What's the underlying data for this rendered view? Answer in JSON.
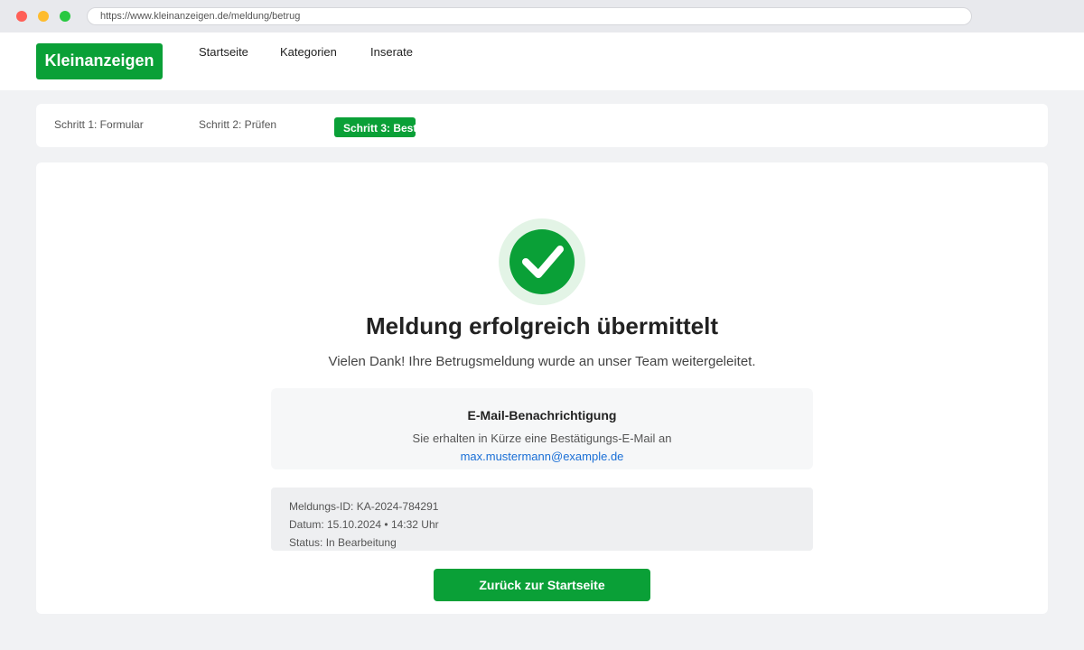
{
  "browser": {
    "url": "https://www.kleinanzeigen.de/meldung/betrug"
  },
  "header": {
    "logo": "Kleinanzeigen",
    "nav": [
      "Startseite",
      "Kategorien",
      "Inserate"
    ]
  },
  "steps": {
    "step1": "Schritt 1: Formular",
    "step2": "Schritt 2: Prüfen",
    "step3": "Schritt 3: Best"
  },
  "confirmation": {
    "icon": "check-circle-icon",
    "title": "Meldung erfolgreich übermittelt",
    "subtitle": "Vielen Dank! Ihre Betrugsmeldung wurde an unser Team weitergeleitet."
  },
  "email_box": {
    "title": "E-Mail-Benachrichtigung",
    "text": "Sie erhalten in Kürze eine Bestätigungs-E-Mail an",
    "address": "max.mustermann@example.de"
  },
  "details": {
    "id": "Meldungs-ID: KA-2024-784291",
    "date": "Datum: 15.10.2024 • 14:32 Uhr",
    "status": "Status: In Bearbeitung"
  },
  "button": {
    "label": "Zurück zur Startseite"
  },
  "colors": {
    "brand": "#0aa037",
    "link": "#1a6fd6",
    "background": "#f1f2f4"
  }
}
